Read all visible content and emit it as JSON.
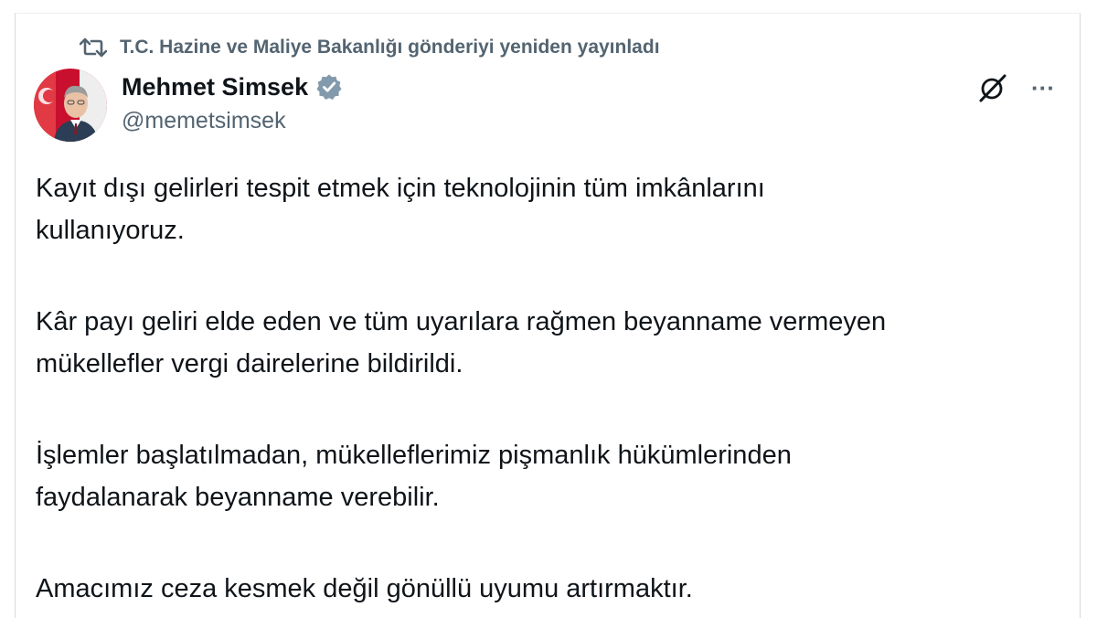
{
  "repost": {
    "text": "T.C. Hazine ve Maliye Bakanlığı gönderiyi yeniden yayınladı",
    "icon": "repost-icon"
  },
  "author": {
    "name": "Mehmet Simsek",
    "handle": "@memetsimsek",
    "verified_icon": "verified-badge-icon",
    "verified_color": "#829aab"
  },
  "actions": {
    "grok_icon": "grok-icon",
    "more_label": "···"
  },
  "tweet": {
    "paragraphs": [
      "Kayıt dışı gelirleri tespit etmek için teknolojinin tüm imkânlarını\nkullanıyoruz.",
      "Kâr payı geliri elde eden ve tüm uyarılara rağmen beyanname vermeyen\nmükellefler vergi dairelerine bildirildi.",
      "İşlemler başlatılmadan, mükelleflerimiz pişmanlık hükümlerinden\nfaydalanarak beyanname verebilir.",
      "Amacımız ceza kesmek değil gönüllü uyumu artırmaktır."
    ]
  },
  "colors": {
    "text_primary": "#0f1419",
    "text_secondary": "#536471",
    "avatar_bg": "#c8102e"
  }
}
